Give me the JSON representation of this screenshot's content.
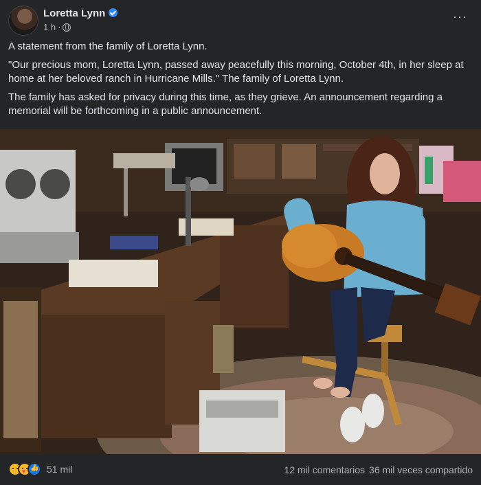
{
  "post": {
    "author": "Loretta Lynn",
    "time": "1 h",
    "separator": "·",
    "more_label": "···",
    "paragraphs": [
      "A statement from the family of Loretta Lynn.",
      "\"Our precious mom, Loretta Lynn, passed away peacefully this morning, October 4th, in her sleep at home at her beloved ranch in Hurricane Mills.\" The family of Loretta Lynn.",
      "The family has asked for privacy during this time, as they grieve. An announcement regarding a memorial will be forthcoming in a public announcement."
    ]
  },
  "photo": {
    "subject": "loretta-lynn-with-guitar-photo"
  },
  "footer": {
    "reaction_icons": [
      "sad-reaction-icon",
      "care-reaction-icon",
      "like-reaction-icon"
    ],
    "reaction_count": "51 mil",
    "comments": "12 mil comentarios",
    "shares": "36 mil veces compartido"
  },
  "colors": {
    "background": "#242526",
    "text_primary": "#e4e6eb",
    "text_secondary": "#b0b3b8",
    "verified": "#2d88ff"
  }
}
